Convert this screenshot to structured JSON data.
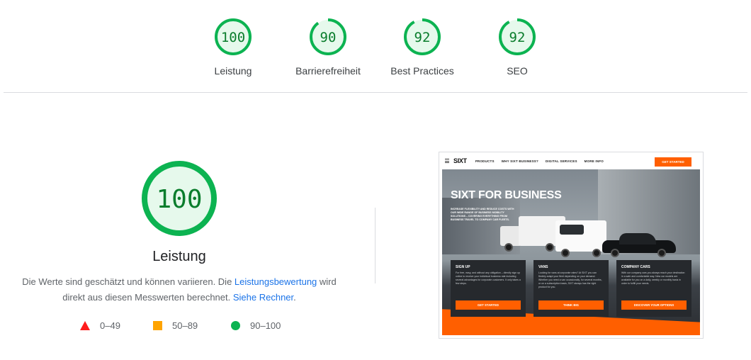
{
  "colors": {
    "pass_green": "#0cb351",
    "pass_text": "#0a7d2c",
    "pass_bg": "#e6f9ec",
    "average_orange": "#ffa400",
    "fail_red": "#ff1c1c",
    "link_blue": "#1a73e8",
    "brand_orange": "#ff5f00"
  },
  "scores": [
    {
      "value": "100",
      "score": 100,
      "label": "Leistung"
    },
    {
      "value": "90",
      "score": 90,
      "label": "Barrierefreiheit"
    },
    {
      "value": "92",
      "score": 92,
      "label": "Best Practices"
    },
    {
      "value": "92",
      "score": 92,
      "label": "SEO"
    }
  ],
  "main": {
    "score": {
      "value": "100",
      "score": 100
    },
    "title": "Leistung",
    "desc_part1": "Die Werte sind geschätzt und können variieren. Die ",
    "desc_link1": "Leistungsbewertung",
    "desc_part2": " wird direkt aus diesen Messwerten berechnet. ",
    "desc_link2": "Siehe Rechner",
    "desc_part3": "."
  },
  "legend": [
    {
      "icon": "triangle-icon",
      "label": "0–49"
    },
    {
      "icon": "square-icon",
      "label": "50–89"
    },
    {
      "icon": "circle-icon",
      "label": "90–100"
    }
  ],
  "thumbnail": {
    "logo_text": "SIXT",
    "nav": [
      "PRODUCTS",
      "WHY SIXT BUSINESS?",
      "DIGITAL SERVICES",
      "MORE INFO"
    ],
    "nav_cta": "GET STARTED",
    "hero_title": "SIXT FOR BUSINESS",
    "hero_sub": "INCREASE FLEXIBILITY AND REDUCE COSTS WITH OUR WIDE RANGE OF BUSINESS MOBILITY SOLUTIONS – COVERING EVERYTHING FROM BUSINESS TRAVEL TO COMPANY CAR FLEETS.",
    "cards": [
      {
        "title": "SIGN UP",
        "body": "For free, easy, and without any obligation – directly sign up online to receive your individual business rate including several advantages for corporate customers. It only takes a few steps.",
        "button": "GET STARTED"
      },
      {
        "title": "VANS",
        "body": "Looking for vans at corporate rates? At SIXT you can flexibly adapt your fleet depending on your demand. Whether you need a van occasionally, for several months, or on a subscription basis, SIXT always has the right product for you.",
        "button": "THINK BIG"
      },
      {
        "title": "COMPANY CARS",
        "body": "With our company cars you always reach your destination in a safe and comfortable way. New car models are available for you on a daily, weekly or monthly basis in order to fulfill your needs.",
        "button": "DISCOVER YOUR OPTIONS"
      }
    ]
  }
}
